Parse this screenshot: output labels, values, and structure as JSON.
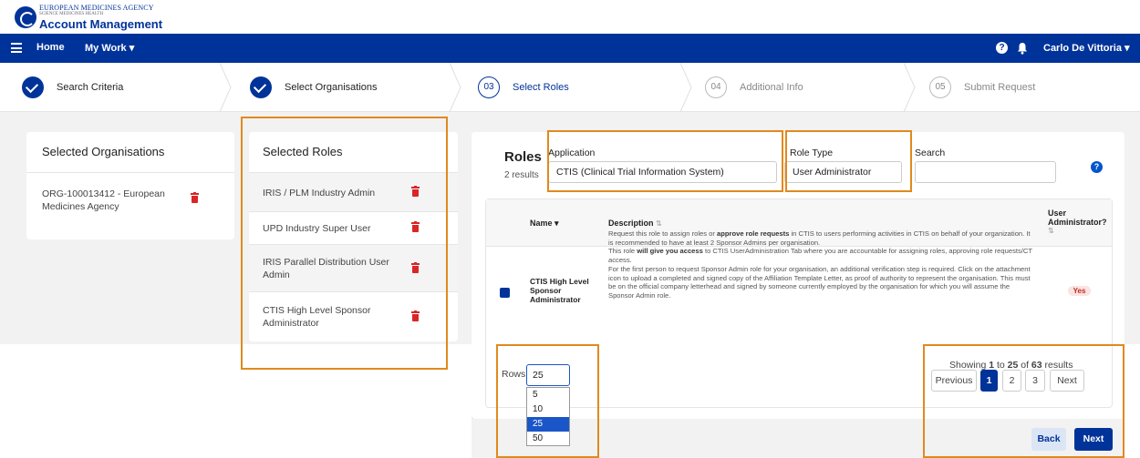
{
  "header": {
    "agency_line1": "EUROPEAN MEDICINES AGENCY",
    "agency_line2": "SCIENCE MEDICINES HEALTH",
    "app_title": "Account Management"
  },
  "nav": {
    "home": "Home",
    "my_work": "My Work ▾",
    "help": "?",
    "user": "Carlo De Vittoria ▾"
  },
  "stepper": {
    "steps": [
      {
        "label": "Search Criteria",
        "state": "done"
      },
      {
        "label": "Select Organisations",
        "state": "done"
      },
      {
        "num": "03",
        "label": "Select Roles",
        "state": "active"
      },
      {
        "num": "04",
        "label": "Additional Info",
        "state": "todo"
      },
      {
        "num": "05",
        "label": "Submit Request",
        "state": "todo"
      }
    ]
  },
  "selected_orgs": {
    "title": "Selected Organisations",
    "items": [
      "ORG-100013412 - European Medicines Agency"
    ]
  },
  "selected_roles": {
    "title": "Selected Roles",
    "items": [
      "IRIS / PLM Industry Admin",
      "UPD Industry Super User",
      "IRIS Parallel Distribution User Admin",
      "CTIS High Level Sponsor Administrator"
    ]
  },
  "roles_panel": {
    "title": "Roles",
    "count": "2 results",
    "application_label": "Application",
    "application_value": "CTIS (Clinical Trial Information System)",
    "role_type_label": "Role Type",
    "role_type_value": "User Administrator",
    "search_label": "Search",
    "search_value": "",
    "help": "?"
  },
  "table": {
    "col_name": "Name ▾",
    "col_desc": "Description",
    "col_desc_sort": "⇅",
    "col_admin_1": "User",
    "col_admin_2": "Administrator?",
    "col_admin_sort": "⇅",
    "rows": [
      {
        "name": "CTIS High Level Sponsor Administrator",
        "desc_a": "Request this role to assign roles or ",
        "desc_b": "approve role requests",
        "desc_c": " in CTIS to users performing activities in CTIS on behalf of your organization. It is recommended to have at least 2 Sponsor Admins per organisation.",
        "desc_d": "This role ",
        "desc_e": "will give you access",
        "desc_f": " to CTIS UserAdministration Tab where you are accountable for assigning roles, approving role requests/CT access.",
        "desc_g": "For the first person to request Sponsor Admin role for your organisation, an additional verification step is required. Click on the attachment icon to upload a completed and signed copy of the Affiliation Template Letter, as proof of authority to represent the organisation. This must be on the official company letterhead and signed by someone currently employed by the organisation for which you will assume the Sponsor Admin role.",
        "admin": "Yes"
      }
    ]
  },
  "pagination": {
    "rows_label": "Rows",
    "rows_value": "25",
    "rows_options": [
      "5",
      "10",
      "25",
      "50"
    ],
    "showing_a": "Showing ",
    "showing_from": "1",
    "showing_b": " to ",
    "showing_to": "25",
    "showing_c": " of ",
    "showing_total": "63",
    "showing_d": " results",
    "previous": "Previous",
    "pages": [
      "1",
      "2",
      "3"
    ],
    "next": "Next"
  },
  "actions": {
    "back": "Back",
    "next": "Next"
  },
  "colors": {
    "brand": "#003399",
    "danger": "#d92626",
    "annotation": "#e08a1e"
  }
}
